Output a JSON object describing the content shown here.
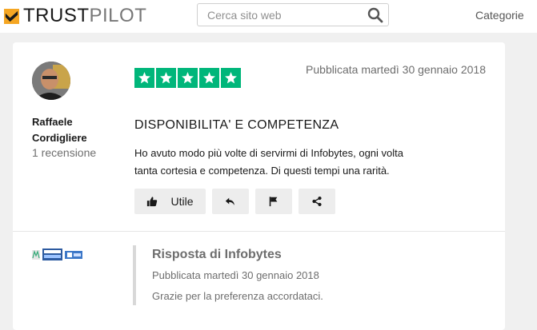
{
  "header": {
    "logo_trust": "TRUST",
    "logo_pilot": "PILOT",
    "logo_star_color": "#f5a623",
    "search_placeholder": "Cerca sito web",
    "categories_label": "Categorie"
  },
  "review": {
    "reviewer_first": "Raffaele",
    "reviewer_last": "Cordigliere",
    "review_count": "1 recensione",
    "rating": 5,
    "star_color": "#00b67a",
    "published": "Pubblicata martedì 30 gennaio 2018",
    "title": "DISPONIBILITA' E COMPETENZA",
    "body": "Ho avuto modo più volte di servirmi di Infobytes, ogni volta tanta cortesia e competenza. Di questi tempi una rarità.",
    "useful_label": "Utile",
    "icons": [
      "thumbs-up-icon",
      "reply-icon",
      "flag-icon",
      "share-icon"
    ]
  },
  "reply": {
    "title": "Risposta di Infobytes",
    "published": "Pubblicata martedì 30 gennaio 2018",
    "body": "Grazie per la preferenza accordataci."
  }
}
